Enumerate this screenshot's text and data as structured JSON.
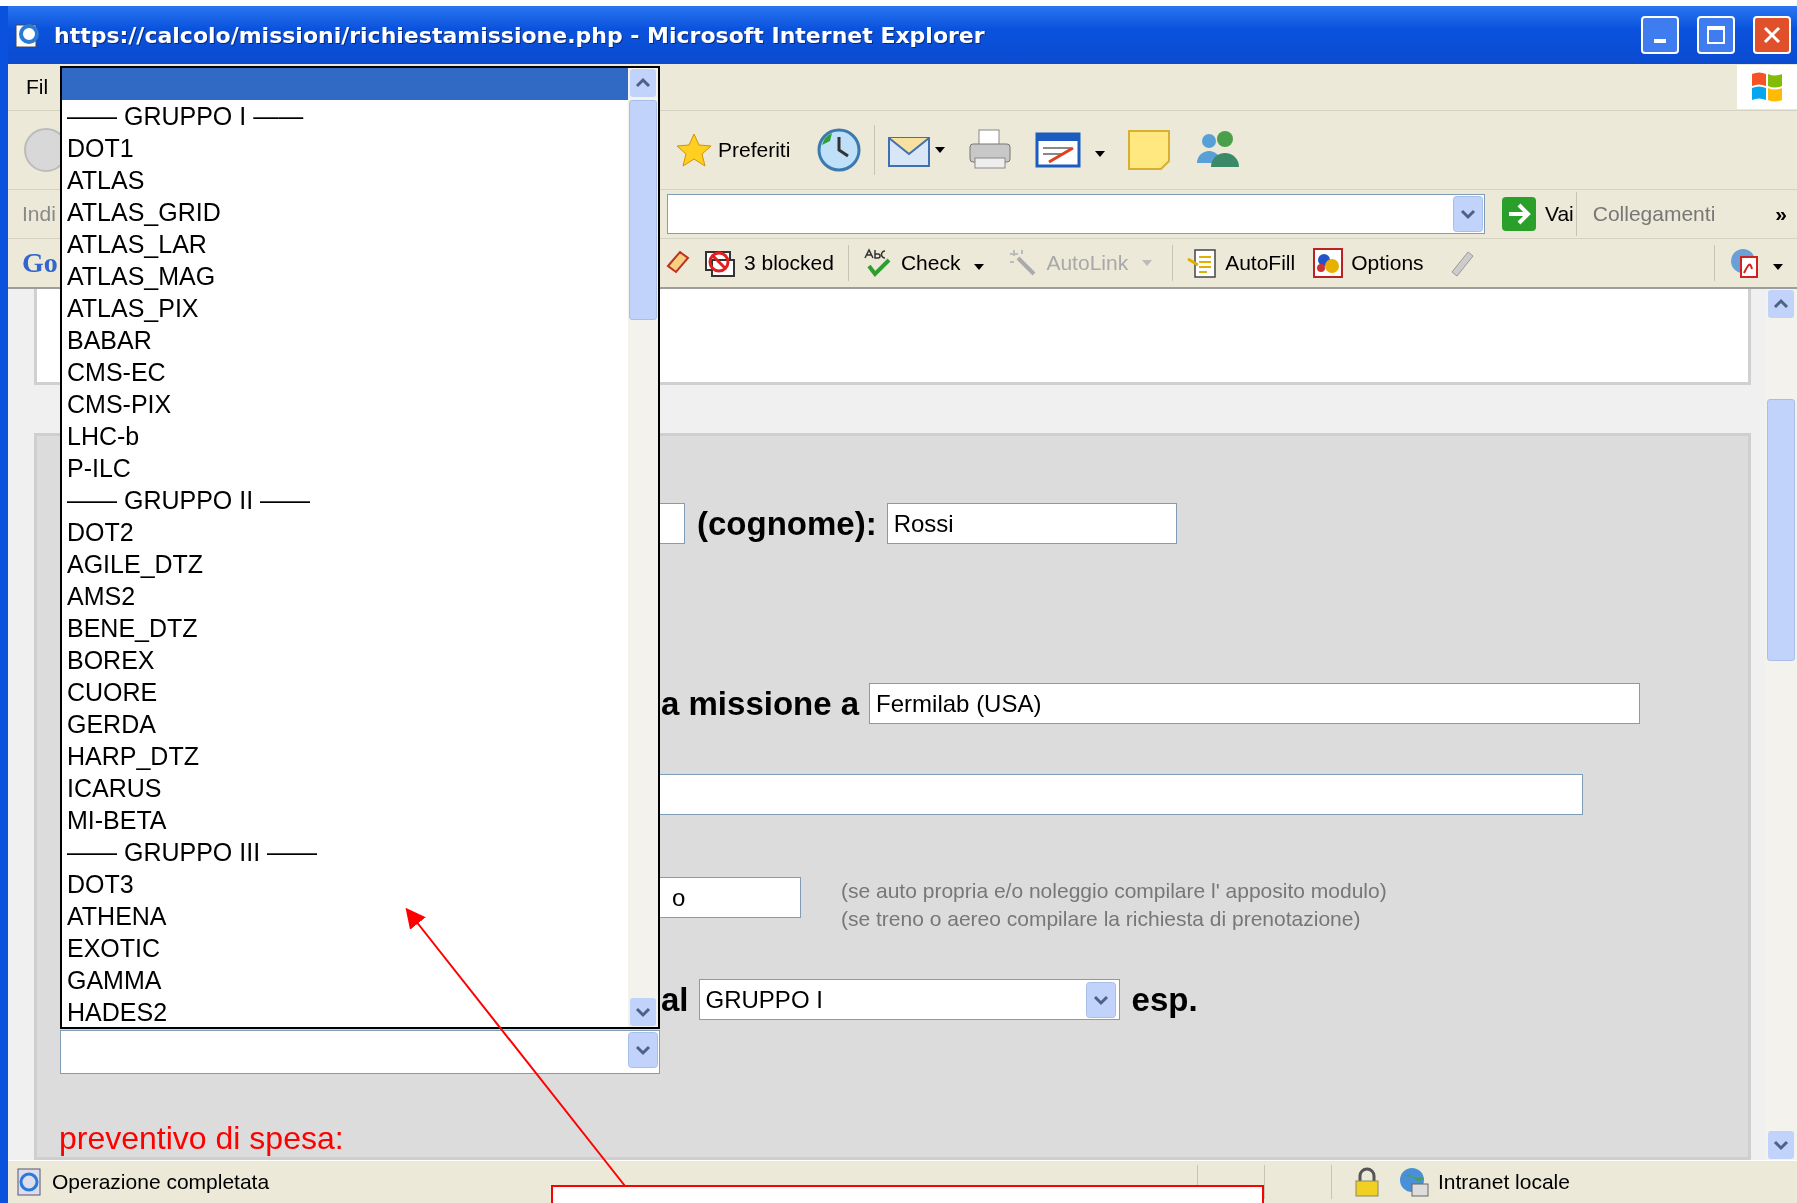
{
  "window": {
    "title": "https://calcolo/missioni/richiestamissione.php - Microsoft Internet Explorer"
  },
  "menu_bar": {
    "items": [
      "Fil"
    ]
  },
  "toolbar": {
    "favorites": "Preferiti"
  },
  "address_bar": {
    "label": "Indi",
    "go_button": "Vai",
    "links": "Collegamenti",
    "more": "»"
  },
  "google_toolbar": {
    "logo": "Go",
    "items": [
      {
        "kind": "popup",
        "label": "3 blocked",
        "disabled": false
      },
      {
        "kind": "spell",
        "label": "Check",
        "disabled": false
      },
      {
        "kind": "autolink",
        "label": "AutoLink",
        "disabled": true
      },
      {
        "kind": "autofill",
        "label": "AutoFill",
        "disabled": false
      },
      {
        "kind": "options",
        "label": "Options",
        "disabled": false
      }
    ]
  },
  "form": {
    "surname_label": "(cognome):",
    "surname": "Rossi",
    "destination_label": "a missione a",
    "destination": "Fermilab (USA)",
    "transport": "o",
    "hints": [
      "(se auto propria e/o noleggio compilare l' apposito modulo)",
      "(se treno o aereo compilare la richiesta di prenotazione)"
    ],
    "group_label": "al",
    "group": "GRUPPO I",
    "group_suffix": "esp.",
    "budget_heading": "preventivo di spesa:"
  },
  "dropdown": {
    "options": [
      {
        "selected": true
      },
      {
        "label": "—— GRUPPO I ——",
        "selected": false
      },
      {
        "label": "DOT1",
        "selected": false
      },
      {
        "label": "ATLAS",
        "selected": false
      },
      {
        "label": "ATLAS_GRID",
        "selected": false
      },
      {
        "label": "ATLAS_LAR",
        "selected": false
      },
      {
        "label": "ATLAS_MAG",
        "selected": false
      },
      {
        "label": "ATLAS_PIX",
        "selected": false
      },
      {
        "label": "BABAR",
        "selected": false
      },
      {
        "label": "CMS-EC",
        "selected": false
      },
      {
        "label": "CMS-PIX",
        "selected": false
      },
      {
        "label": "LHC-b",
        "selected": false
      },
      {
        "label": "P-ILC",
        "selected": false
      },
      {
        "label": "—— GRUPPO II ——",
        "selected": false
      },
      {
        "label": "DOT2",
        "selected": false
      },
      {
        "label": "AGILE_DTZ",
        "selected": false
      },
      {
        "label": "AMS2",
        "selected": false
      },
      {
        "label": "BENE_DTZ",
        "selected": false
      },
      {
        "label": "BOREX",
        "selected": false
      },
      {
        "label": "CUORE",
        "selected": false
      },
      {
        "label": "GERDA",
        "selected": false
      },
      {
        "label": "HARP_DTZ",
        "selected": false
      },
      {
        "label": "ICARUS",
        "selected": false
      },
      {
        "label": "MI-BETA",
        "selected": false
      },
      {
        "label": "—— GRUPPO III ——",
        "selected": false
      },
      {
        "label": "DOT3",
        "selected": false
      },
      {
        "label": "ATHENA",
        "selected": false
      },
      {
        "label": "EXOTIC",
        "selected": false
      },
      {
        "label": "GAMMA",
        "selected": false
      },
      {
        "label": "HADES2",
        "selected": false
      }
    ]
  },
  "status_bar": {
    "text": "Operazione completata",
    "zone": "Intranet locale"
  }
}
